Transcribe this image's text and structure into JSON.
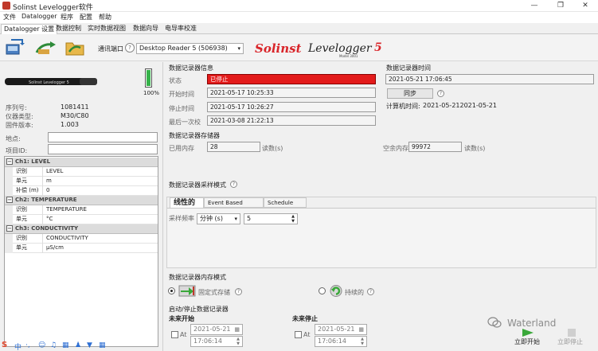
{
  "window": {
    "title": "Solinst Levelogger软件",
    "buttons": [
      "—",
      "❐",
      "✕"
    ]
  },
  "menu": [
    "文件",
    "Datalogger",
    "程序",
    "配置",
    "帮助"
  ],
  "tabs": [
    "Datalogger 设置",
    "数据控制",
    "实时数据视图",
    "数据向导",
    "电导率校准"
  ],
  "toolbar": {
    "port_label": "通讯端口",
    "port_value": "Desktop Reader 5 (506938)",
    "brand": "Solinst",
    "product": "Levelogger",
    "product_version": "5",
    "product_model": "Model 3001"
  },
  "device": {
    "image_text": "Solinst Levelogger 5",
    "battery": "100%",
    "info": [
      {
        "label": "序列号:",
        "value": "1081411"
      },
      {
        "label": "仪器类型:",
        "value": "M30/C80"
      },
      {
        "label": "固件版本:",
        "value": "1.003"
      }
    ],
    "location_label": "地点:",
    "location_value": "",
    "project_label": "项目ID:",
    "project_value": ""
  },
  "channels": [
    {
      "header": "Ch1: LEVEL",
      "rows": [
        {
          "k": "识别",
          "v": "LEVEL"
        },
        {
          "k": "单元",
          "v": "m"
        },
        {
          "k": "补偿 (m)",
          "v": "0"
        }
      ]
    },
    {
      "header": "Ch2: TEMPERATURE",
      "rows": [
        {
          "k": "识别",
          "v": "TEMPERATURE"
        },
        {
          "k": "单元",
          "v": "°C"
        }
      ]
    },
    {
      "header": "Ch3: CONDUCTIVITY",
      "rows": [
        {
          "k": "识别",
          "v": "CONDUCTIVITY"
        },
        {
          "k": "单元",
          "v": "μS/cm"
        }
      ]
    }
  ],
  "logger_info": {
    "title": "数据记录器信息",
    "status_label": "状态",
    "status_value": "已停止",
    "status_color": "#e31b1b",
    "start_label": "开始时间",
    "start_value": "2021-05-17 10:25:33",
    "stop_label": "停止时间",
    "stop_value": "2021-05-17 10:26:27",
    "calib_label": "最后一次校",
    "calib_value": "2021-03-08 21:22:13"
  },
  "logger_time": {
    "title": "数据记录器时间",
    "value": "2021-05-21 17:06:45",
    "sync_label": "同步",
    "computer_time_label": "计算机时间:",
    "computer_time_value": "2021-05-212021-05-21"
  },
  "memory": {
    "title": "数据记录器存储器",
    "used_label": "已用内存",
    "used_value": "28",
    "used_unit": "读数(s)",
    "free_label": "空余内存",
    "free_value": "99972",
    "free_unit": "读数(s)"
  },
  "sampling": {
    "title": "数据记录器采样模式",
    "tabs": [
      "线性的",
      "Event Based",
      "Schedule"
    ],
    "rate_label": "采样频率",
    "rate_unit": "分钟 (s)",
    "rate_value": "5"
  },
  "memory_mode": {
    "title": "数据记录器内存模式",
    "fixed_label": "固定式存储",
    "continuous_label": "持续的"
  },
  "startstop": {
    "title": "启动/停止数据记录器",
    "start_heading": "未来开始",
    "stop_heading": "未来停止",
    "at_label": "At",
    "start_date": "2021-05-21",
    "start_time": "17:06:14",
    "stop_date": "2021-05-21",
    "stop_time": "17:06:14",
    "start_now": "立即开始",
    "stop_now": "立即停止"
  },
  "watermark": "Waterland",
  "colors": {
    "brand_red": "#d9252a",
    "status_red": "#e31b1b"
  }
}
